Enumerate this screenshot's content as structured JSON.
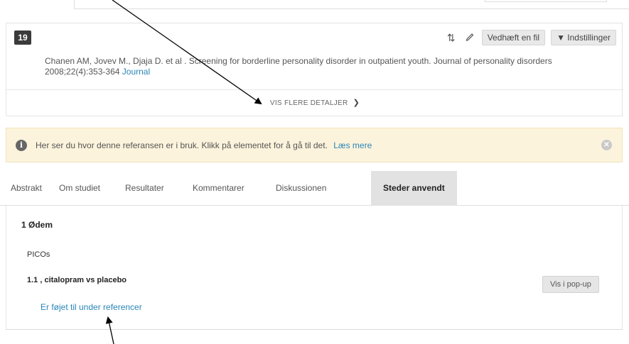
{
  "reference": {
    "number": "19",
    "citation": "Chanen AM, Jovev M., Djaja D. et al . Screening for borderline personality disorder in outpatient youth. Journal of personality disorders 2008;22(4):353-364",
    "journal_link": "Journal",
    "attach_file_label": "Vedhæft en fil",
    "settings_label": "▼ Indstillinger",
    "more_details_label": "VIS FLERE DETALJER"
  },
  "info": {
    "text": "Her ser du hvor denne referansen er i bruk. Klikk på elementet for å gå til det.",
    "link": "Læs mere"
  },
  "tabs": [
    {
      "label": "Abstrakt"
    },
    {
      "label": "Om studiet"
    },
    {
      "label": "Resultater"
    },
    {
      "label": "Kommentarer"
    },
    {
      "label": "Diskussionen"
    },
    {
      "label": "Steder anvendt"
    }
  ],
  "usage": {
    "section_title": "1 Ødem",
    "picos_label": "PICOs",
    "comparison": "1.1 , citalopram vs placebo",
    "popup_button": "Vis i pop-up",
    "added_link": "Er føjet til under referencer"
  },
  "icons": {
    "sort": "sort-icon",
    "edit": "pencil-icon",
    "info": "info-icon",
    "close": "close-icon",
    "chevron": "chevron-down-icon"
  },
  "colors": {
    "link": "#2a86b8",
    "banner_bg": "#fcf3dc",
    "badge_bg": "#3b3b3b",
    "active_tab_bg": "#e2e2e2"
  }
}
